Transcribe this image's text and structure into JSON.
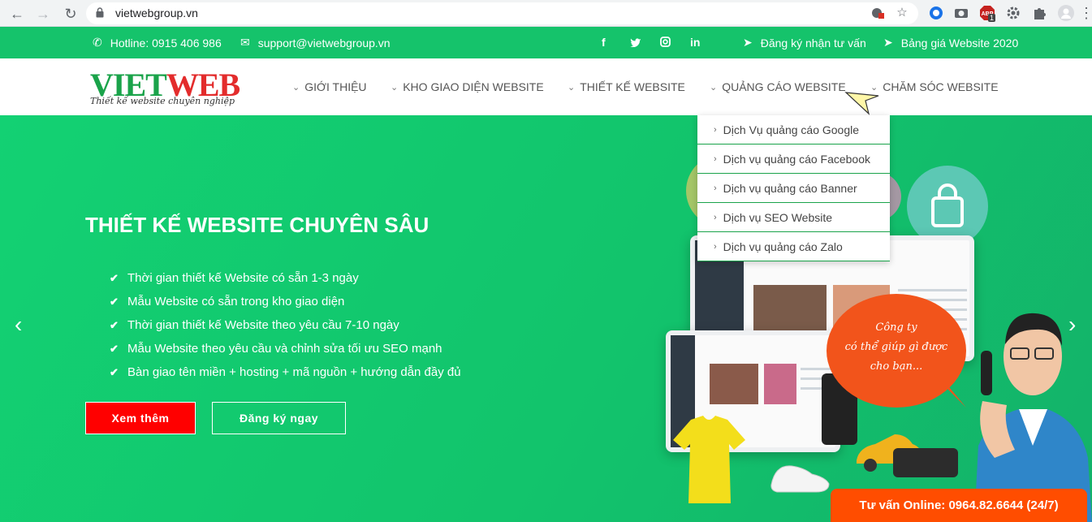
{
  "browser": {
    "url": "vietwebgroup.vn",
    "abp_badge": "1"
  },
  "topbar": {
    "hotline": "Hotline: 0915 406 986",
    "email": "support@vietwebgroup.vn",
    "social": [
      "f",
      "t",
      "ig",
      "in"
    ],
    "register_advice": "Đăng ký nhận tư vấn",
    "price_list": "Bảng giá Website 2020"
  },
  "logo": {
    "brand_v": "VIET",
    "brand_w": "WEB",
    "tagline": "Thiết kế website chuyên nghiệp"
  },
  "menu": {
    "items": [
      {
        "label": "GIỚI THIỆU"
      },
      {
        "label": "KHO GIAO DIỆN WEBSITE"
      },
      {
        "label": "THIẾT KẾ WEBSITE"
      },
      {
        "label": "QUẢNG CÁO WEBSITE"
      },
      {
        "label": "CHĂM SÓC WEBSITE"
      }
    ]
  },
  "dropdown": {
    "items": [
      {
        "label": "Dịch Vụ quảng cáo Google"
      },
      {
        "label": "Dịch vụ quảng cáo Facebook"
      },
      {
        "label": "Dịch vụ quảng cáo Banner"
      },
      {
        "label": "Dịch vụ SEO Website"
      },
      {
        "label": "Dịch vụ quảng cáo Zalo"
      }
    ]
  },
  "hero": {
    "title": "THIẾT KẾ WEBSITE CHUYÊN SÂU",
    "features": [
      "Thời gian thiết kế Website có sẵn 1-3 ngày",
      "Mẫu Website có sẵn trong kho giao diện",
      "Thời gian thiết kế Website theo yêu cầu 7-10 ngày",
      "Mẫu Website theo yêu cầu và chỉnh sửa tối ưu SEO mạnh",
      "Bàn giao tên miền + hosting + mã nguồn + hướng dẫn đầy đủ"
    ],
    "btn_more": "Xem thêm",
    "btn_register": "Đăng ký ngay",
    "bubble_line1": "Công ty",
    "bubble_line2": "có thể giúp gì được",
    "bubble_line3": "cho bạn..."
  },
  "consult": {
    "label": "Tư vấn Online: 0964.82.6644 (24/7)"
  },
  "colors": {
    "green_bar": "#15c36b",
    "hero_green": "#13d173",
    "accent_red": "#ff0000",
    "consult_orange": "#ff4d00"
  }
}
